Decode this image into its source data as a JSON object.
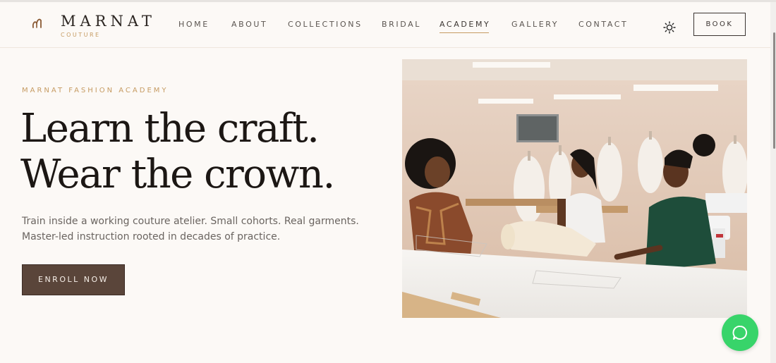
{
  "brand": {
    "name": "MARNAT",
    "subtitle": "COUTURE"
  },
  "nav": {
    "items": [
      {
        "label": "HOME",
        "name": "nav-home"
      },
      {
        "label": "ABOUT",
        "name": "nav-about"
      },
      {
        "label": "COLLECTIONS",
        "name": "nav-collections"
      },
      {
        "label": "BRIDAL",
        "name": "nav-bridal"
      },
      {
        "label": "ACADEMY",
        "name": "nav-academy"
      },
      {
        "label": "GALLERY",
        "name": "nav-gallery"
      },
      {
        "label": "CONTACT",
        "name": "nav-contact"
      }
    ],
    "active": "ACADEMY",
    "book_label": "BOOK",
    "theme_icon": "sun-icon"
  },
  "hero": {
    "eyebrow": "MARNAT FASHION ACADEMY",
    "headline_line1": "Learn the craft.",
    "headline_line2": "Wear the crown.",
    "description": "Train inside a working couture atelier. Small cohorts. Real garments. Master-led instruction rooted in decades of practice.",
    "cta_label": "ENROLL NOW",
    "image": "photo: three women working at a long white cutting table in a bright sewing atelier with dress forms and sewing machines"
  },
  "chat": {
    "icon": "chat-bubble-icon"
  },
  "colors": {
    "background": "#fcf9f6",
    "accent_gold": "#c69b62",
    "cta_brown": "#5a453a",
    "chat_green": "#38d46a",
    "text_dark": "#1c1714"
  }
}
